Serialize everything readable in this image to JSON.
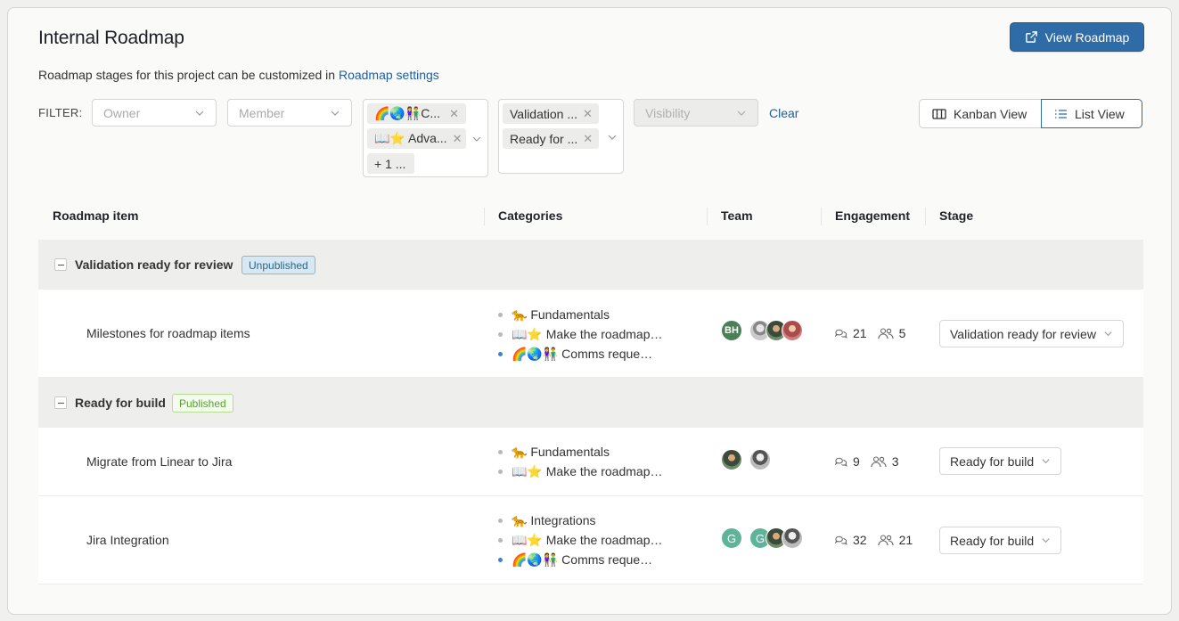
{
  "header": {
    "title": "Internal Roadmap",
    "subtitle_prefix": "Roadmap stages for this project can be customized in ",
    "subtitle_link": "Roadmap settings",
    "view_roadmap_label": "View Roadmap"
  },
  "filters": {
    "label": "FILTER:",
    "owner_placeholder": "Owner",
    "member_placeholder": "Member",
    "category_tags": [
      "🌈🌏👫C...",
      "📖⭐ Adva...",
      "+ 1 ..."
    ],
    "stage_tags": [
      "Validation ...",
      "Ready for ..."
    ],
    "visibility_placeholder": "Visibility",
    "clear_label": "Clear"
  },
  "views": {
    "kanban_label": "Kanban View",
    "list_label": "List View"
  },
  "table": {
    "headers": {
      "item": "Roadmap item",
      "categories": "Categories",
      "team": "Team",
      "engagement": "Engagement",
      "stage": "Stage"
    },
    "groups": [
      {
        "name": "Validation ready for review",
        "badge": "Unpublished",
        "items": [
          {
            "title": "Milestones for roadmap items",
            "categories": [
              "🐆 Fundamentals",
              "📖⭐ Make the roadmap…",
              "🌈🌏👫 Comms reque…"
            ],
            "avatars": [
              "BH",
              "",
              "",
              ""
            ],
            "comments": "21",
            "voters": "5",
            "stage": "Validation ready for review"
          }
        ]
      },
      {
        "name": "Ready for build",
        "badge": "Published",
        "items": [
          {
            "title": "Migrate from Linear to Jira",
            "categories": [
              "🐆 Fundamentals",
              "📖⭐ Make the roadmap…"
            ],
            "avatars": [
              "",
              ""
            ],
            "comments": "9",
            "voters": "3",
            "stage": "Ready for build"
          },
          {
            "title": "Jira Integration",
            "categories": [
              "🐆 Integrations",
              "📖⭐ Make the roadmap…",
              "🌈🌏👫 Comms reque…"
            ],
            "avatars": [
              "G",
              "G",
              "",
              ""
            ],
            "comments": "32",
            "voters": "21",
            "stage": "Ready for build"
          }
        ]
      }
    ]
  },
  "colors": {
    "primary": "#2f6ba6",
    "link": "#1f5fa3",
    "unpublished_badge": "#d7e8f2",
    "published_badge": "#f5fbef"
  }
}
